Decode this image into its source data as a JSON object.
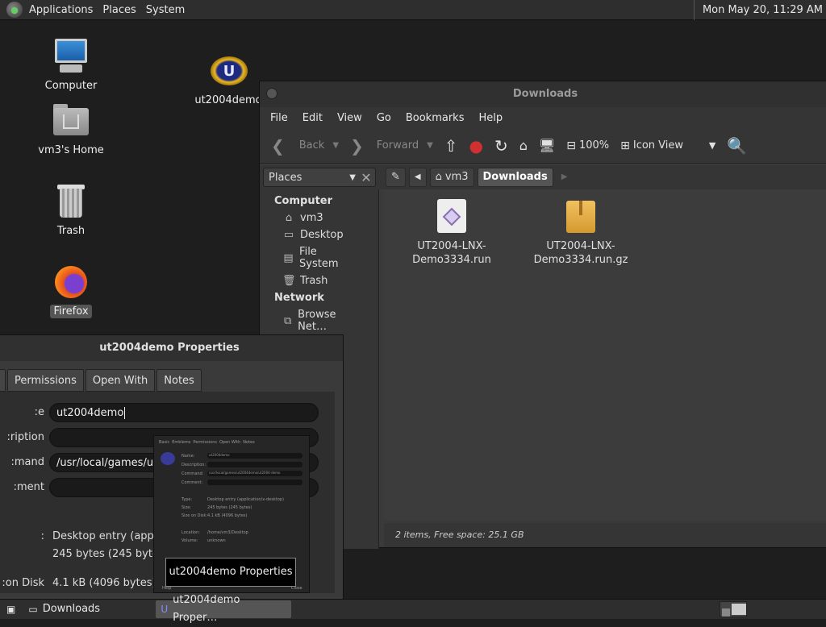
{
  "topbar": {
    "menus": [
      "Applications",
      "Places",
      "System"
    ],
    "clock": "Mon May 20, 11:29 AM"
  },
  "desktop": {
    "icons": [
      {
        "label": "Computer",
        "icon": "computer-icon"
      },
      {
        "label": "vm3's Home",
        "icon": "home-folder-icon"
      },
      {
        "label": "Trash",
        "icon": "trash-icon"
      },
      {
        "label": "Firefox",
        "icon": "firefox-icon"
      },
      {
        "label": "ut2004demo",
        "icon": "ut2004-icon"
      }
    ]
  },
  "file_manager": {
    "title": "Downloads",
    "menu": [
      "File",
      "Edit",
      "View",
      "Go",
      "Bookmarks",
      "Help"
    ],
    "toolbar": {
      "back": "Back",
      "forward": "Forward",
      "zoom": "100%",
      "view_mode": "Icon View"
    },
    "side_pane_label": "Places",
    "breadcrumb": [
      "vm3",
      "Downloads"
    ],
    "sidebar": {
      "computer_header": "Computer",
      "computer_items": [
        "vm3",
        "Desktop",
        "File System",
        "Trash"
      ],
      "network_header": "Network",
      "network_items": [
        "Browse Net…"
      ]
    },
    "files": [
      {
        "line1": "UT2004-LNX-",
        "line2": "Demo3334.run"
      },
      {
        "line1": "UT2004-LNX-",
        "line2": "Demo3334.run.gz"
      }
    ],
    "status": "2 items, Free space: 25.1 GB"
  },
  "properties": {
    "title": "ut2004demo Properties",
    "tabs": [
      "Permissions",
      "Open With",
      "Notes"
    ],
    "fields": {
      "name_label": "e:",
      "name_value": "ut2004demo",
      "description_label": "ription:",
      "description_value": "",
      "command_label": "mand:",
      "command_value": "/usr/local/games/ut2",
      "comment_label": "ment:",
      "comment_value": "",
      "type_label": ":",
      "type_value": "Desktop entry (applic",
      "size_value": "245 bytes (245 bytes)",
      "disk_label": "on Disk:",
      "disk_value": "4.1 kB (4096 bytes)"
    }
  },
  "thumbnail": {
    "tabs": [
      "Basic",
      "Emblems",
      "Permissions",
      "Open With",
      "Notes"
    ],
    "rows": [
      "Name:",
      "Description:",
      "Command:",
      "Comment:",
      "Type:",
      "Size:",
      "Size on Disk:",
      "Location:",
      "Volume:"
    ],
    "values": [
      "ut2004demo",
      "/usr/local/games/ut2004demo/ut2004-demo",
      "Desktop entry (application/x-desktop)",
      "245 bytes (245 bytes)",
      "4.1 kB (4096 bytes)",
      "/home/vm3/Desktop",
      "unknown"
    ],
    "buttons": [
      "Help",
      "Close"
    ]
  },
  "tooltip": "ut2004demo Properties",
  "taskbar": {
    "items": [
      "Downloads",
      "ut2004demo Proper…"
    ]
  }
}
